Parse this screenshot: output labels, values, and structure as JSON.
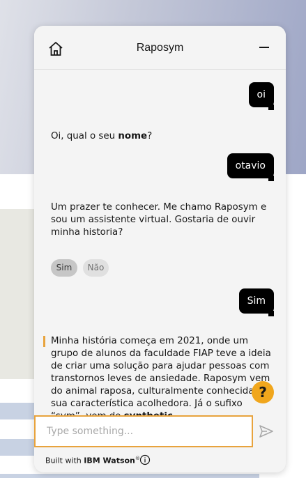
{
  "widget": {
    "title": "Raposym"
  },
  "messages": {
    "user_1": "oi",
    "bot_1_prefix": "Oi, qual o seu ",
    "bot_1_bold": "nome",
    "bot_1_suffix": "?",
    "user_2": "otavio",
    "bot_2": "Um prazer te conhecer. Me chamo Raposym e sou um assistente virtual. Gostaria de ouvir minha historia?",
    "option_yes": "Sim",
    "option_no": "Não",
    "user_3": "Sim",
    "bot_3_main": "Minha história começa em 2021, onde um grupo de alunos da faculdade FIAP teve a ideia de criar uma solução para ajudar pessoas com transtornos leves de ansiedade. Raposym vem do animal raposa, culturalmente conhecida por sua característica acolhedora. Já o sufixo “sym”, vem do ",
    "bot_3_bold": "synthetic",
    "bot_3_end": ""
  },
  "help_button": {
    "label": "?"
  },
  "input": {
    "placeholder": "Type something..."
  },
  "footer": {
    "built_with": "Built with ",
    "brand": "IBM Watson",
    "registered": "®"
  },
  "icons": {
    "home": "home-icon",
    "minimize": "minimize-icon",
    "send": "send-icon",
    "info": "info-icon",
    "help": "question-icon"
  },
  "colors": {
    "accent": "#e8a33d",
    "help": "#f0a61c",
    "user_bubble": "#000000"
  }
}
